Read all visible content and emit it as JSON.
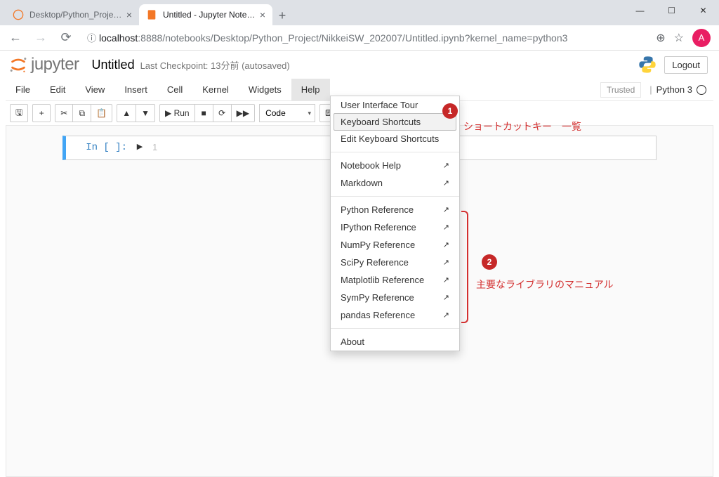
{
  "window": {
    "min": "—",
    "max": "☐",
    "close": "✕"
  },
  "browser": {
    "tabs": [
      {
        "title": "Desktop/Python_Project/NikkeiS"
      },
      {
        "title": "Untitled - Jupyter Notebook"
      }
    ],
    "url_host": "localhost",
    "url_path": ":8888/notebooks/Desktop/Python_Project/NikkeiSW_202007/Untitled.ipynb?kernel_name=python3",
    "avatar": "A",
    "info_icon": "ⓘ"
  },
  "jupyter": {
    "logo_text": "jupyter",
    "notebook_name": "Untitled",
    "checkpoint": "Last Checkpoint: 13分前  (autosaved)",
    "logout": "Logout",
    "trusted": "Trusted",
    "kernel": "Python 3"
  },
  "menubar": [
    "File",
    "Edit",
    "View",
    "Insert",
    "Cell",
    "Kernel",
    "Widgets",
    "Help"
  ],
  "toolbar": {
    "save": "🖫",
    "add": "+",
    "cut": "✂",
    "copy": "⧉",
    "paste": "📋",
    "up": "▲",
    "down": "▼",
    "run": "▶ Run",
    "stop": "■",
    "restart": "⟳",
    "ff": "▶▶",
    "cell_type": "Code",
    "cmd": "⌨"
  },
  "cell": {
    "prompt": "In [ ]:",
    "run_icon": "▶",
    "line_number": "1"
  },
  "help_menu": {
    "items1": [
      "User Interface Tour",
      "Keyboard Shortcuts",
      "Edit Keyboard Shortcuts"
    ],
    "items2": [
      "Notebook Help",
      "Markdown"
    ],
    "items3": [
      "Python Reference",
      "IPython Reference",
      "NumPy Reference",
      "SciPy Reference",
      "Matplotlib Reference",
      "SymPy Reference",
      "pandas Reference"
    ],
    "items4": [
      "About"
    ]
  },
  "annotations": {
    "badge1": "1",
    "text1": "ショートカットキー　一覧",
    "badge2": "2",
    "text2": "主要なライブラリのマニュアル"
  }
}
